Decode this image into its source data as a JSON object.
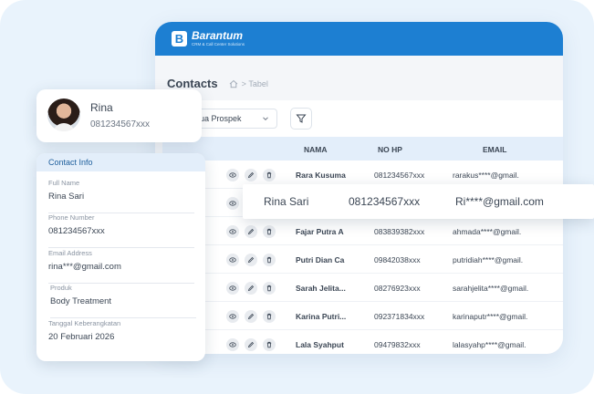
{
  "app": {
    "brand": "Barantum",
    "tagline": "CRM & Call Center Solutions",
    "brand_color": "#1d7fd2",
    "page_title": "Contacts",
    "breadcrumb": "Tabel",
    "filter_value": "ua Prospek"
  },
  "table": {
    "headers": [
      "NAMA",
      "NO HP",
      "EMAIL"
    ],
    "rows": [
      {
        "name": "Rara Kusuma",
        "phone": "081234567xxx",
        "email": "rarakus****@gmail."
      },
      {
        "name": "",
        "phone": "",
        "email": ""
      },
      {
        "name": "Fajar Putra A",
        "phone": "083839382xxx",
        "email": "ahmada****@gmail."
      },
      {
        "name": "Putri Dian Ca",
        "phone": "09842038xxx",
        "email": "putridiah****@gmail."
      },
      {
        "name": "Sarah Jelita...",
        "phone": "08276923xxx",
        "email": "sarahjelita****@gmail."
      },
      {
        "name": "Karina Putri...",
        "phone": "092371834xxx",
        "email": "karinaputr****@gmail."
      },
      {
        "name": "Lala Syahput",
        "phone": "09479832xxx",
        "email": "lalasyahp****@gmail."
      }
    ]
  },
  "highlight": {
    "name": "Rina Sari",
    "phone": "081234567xxx",
    "email": "Ri****@gmail.com"
  },
  "profile": {
    "name": "Rina",
    "phone": "081234567xxx"
  },
  "contact_info": {
    "title": "Contact Info",
    "fields": [
      {
        "label": "Full Name",
        "value": "Rina Sari"
      },
      {
        "label": "Phone Number",
        "value": "081234567xxx"
      },
      {
        "label": "Email Address",
        "value": "rina***@gmail.com"
      },
      {
        "label": "Produk",
        "value": "Body Treatment"
      },
      {
        "label": "Tanggal Keberangkatan",
        "value": "20 Februari 2026"
      }
    ]
  }
}
